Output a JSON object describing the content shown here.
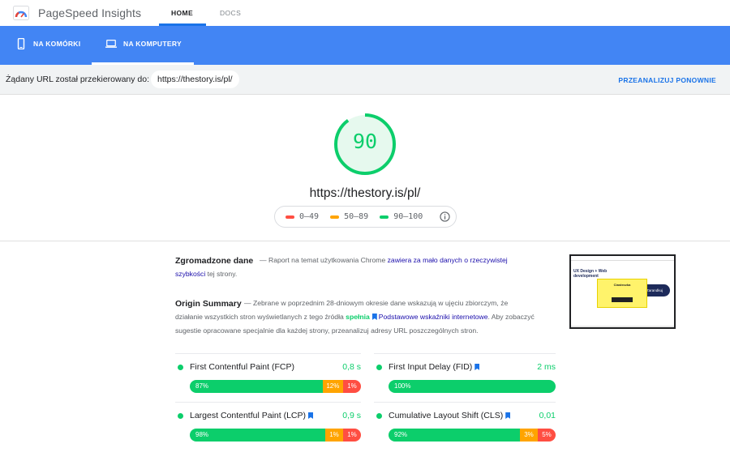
{
  "header": {
    "brand": "PageSpeed Insights",
    "tabs": [
      "HOME",
      "DOCS"
    ],
    "active_tab": "HOME"
  },
  "devices": {
    "mobile": "NA KOMÓRKI",
    "desktop": "NA KOMPUTERY",
    "active": "NA KOMPUTERY"
  },
  "urlbar": {
    "redirect_label": "Żądany URL został przekierowany do:",
    "url": "https://thestory.is/pl/",
    "reanalyze": "PRZEANALIZUJ PONOWNIE"
  },
  "score": {
    "value": "90",
    "fraction": 0.9,
    "url": "https://thestory.is/pl/",
    "legend": [
      "0–49",
      "50–89",
      "90–100"
    ],
    "colors": {
      "poor": "#ff4e42",
      "average": "#ffa400",
      "good": "#0cce6b"
    }
  },
  "field": {
    "title": "Zgromadzone dane",
    "text_before": "— Raport na temat użytkowania Chrome",
    "link": "zawiera za mało danych o rzeczywistej szybkości",
    "text_after": "tej strony."
  },
  "origin": {
    "title": "Origin Summary",
    "text_before": "— Zebrane w poprzednim 28-dniowym okresie dane wskazują w ujęciu zbiorczym, że działanie wszystkich stron wyświetlanych z tego źródła",
    "pass": "spełnia",
    "link": "Podstawowe wskaźniki internetowe",
    "text_after": ". Aby zobaczyć sugestie opracowane specjalnie dla każdej strony, przeanalizuj adresy URL poszczególnych stron."
  },
  "metrics": [
    {
      "name": "First Contentful Paint (FCP)",
      "value": "0,8 s",
      "flag": false,
      "dist": [
        87,
        12,
        1
      ],
      "labels": [
        "87%",
        "12%",
        "1%"
      ]
    },
    {
      "name": "First Input Delay (FID)",
      "value": "2 ms",
      "flag": true,
      "dist": [
        100,
        0,
        0
      ],
      "labels": [
        "100%",
        "",
        ""
      ]
    },
    {
      "name": "Largest Contentful Paint (LCP)",
      "value": "0,9 s",
      "flag": true,
      "dist": [
        98,
        1,
        1
      ],
      "labels": [
        "98%",
        "1%",
        "1%"
      ]
    },
    {
      "name": "Cumulative Layout Shift (CLS)",
      "value": "0,01",
      "flag": true,
      "dist": [
        92,
        3,
        5
      ],
      "labels": [
        "92%",
        "3%",
        "5%"
      ]
    }
  ],
  "thumbnail": {
    "headline": "UX Design + Web development",
    "popup_title": "Ciasteczka",
    "cta": "Zarandkuj"
  }
}
